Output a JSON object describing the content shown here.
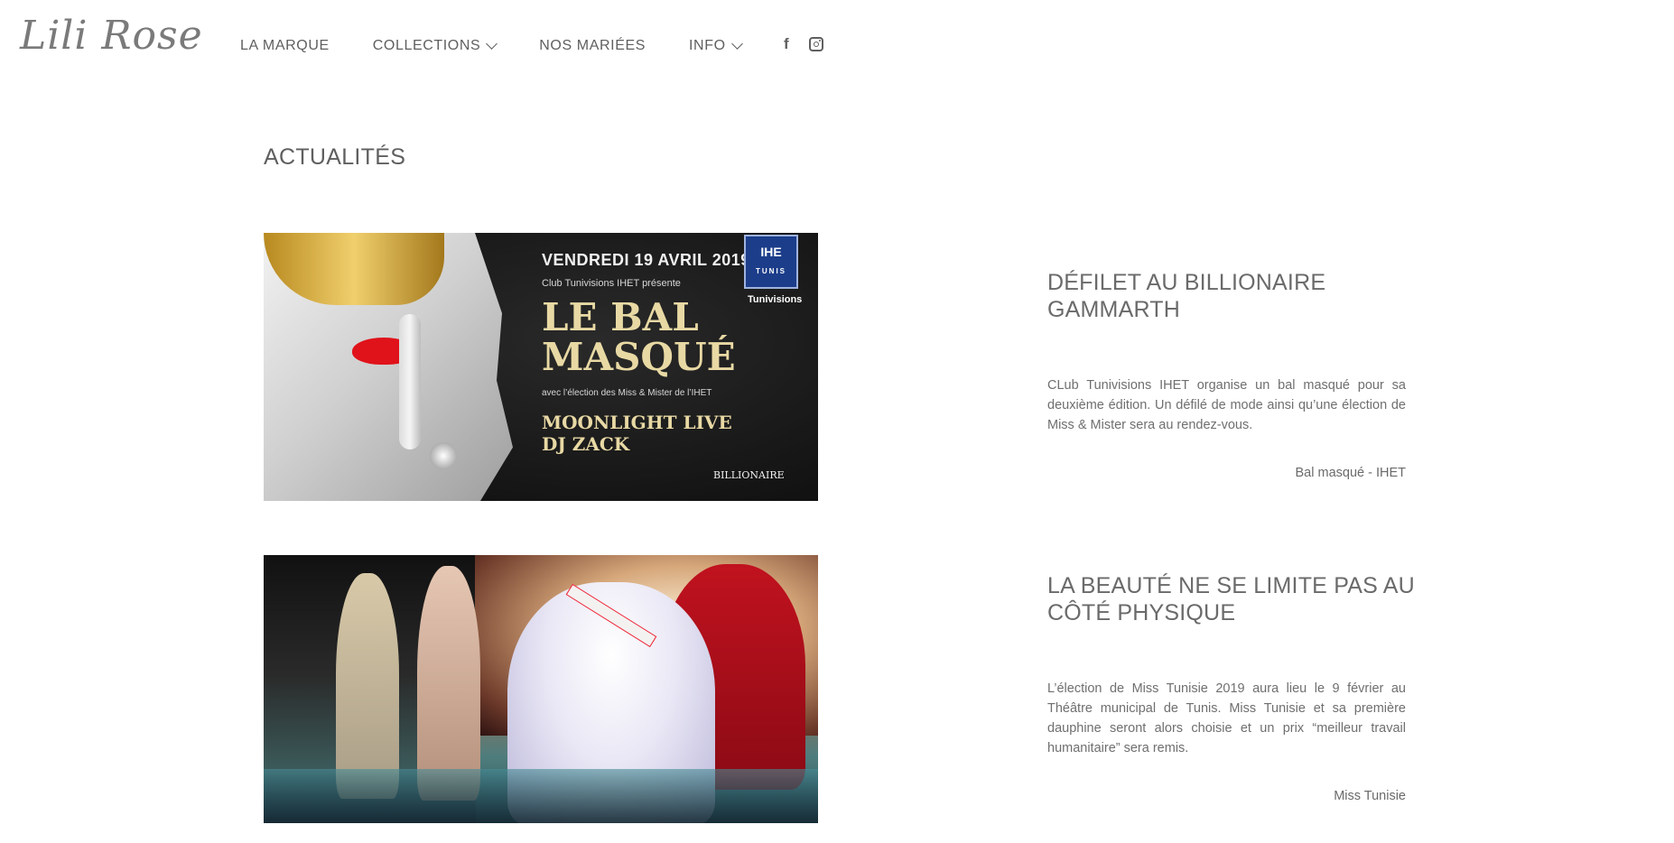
{
  "header": {
    "logo": "Lili Rose",
    "nav": [
      {
        "label": "LA MARQUE",
        "dropdown": false
      },
      {
        "label": "COLLECTIONS",
        "dropdown": true
      },
      {
        "label": "NOS MARIÉES",
        "dropdown": false
      },
      {
        "label": "INFO",
        "dropdown": true
      }
    ],
    "social": {
      "facebook_glyph": "f",
      "icons": [
        "facebook-icon",
        "instagram-icon"
      ]
    }
  },
  "page": {
    "title": "ACTUALITÉS"
  },
  "articles": [
    {
      "title": "DÉFILET AU BILLIONAIRE GAMMARTH",
      "text": "CLub Tunivisions IHET organise un bal masqué pour sa deuxième édition. Un défilé de mode ainsi qu’une élection de Miss & Mister sera au rendez-vous.",
      "tag": "Bal masqué - IHET",
      "poster": {
        "date": "VENDREDI 19 AVRIL 2019",
        "club": "Club Tunivisions IHET présente",
        "headline_1": "LE BAL",
        "headline_2": "MASQUÉ",
        "subline": "avec l’élection des Miss & Mister de l’IHET",
        "live_1": "MOONLIGHT LIVE",
        "live_2": "DJ ZACK",
        "badge_top": "IHE",
        "badge_bottom": "TUNIS",
        "tunivisions": "Tunivisions",
        "venue": "BILLIONAIRE"
      }
    },
    {
      "title": "LA BEAUTÉ NE SE LIMITE PAS AU CÔTÉ PHYSIQUE",
      "text": "L’élection de Miss Tunisie 2019 aura lieu le 9 février au Théâtre municipal de Tunis. Miss Tunisie et sa première dauphine seront alors choisie et un prix “meilleur travail humanitaire” sera remis.",
      "tag": "Miss Tunisie"
    }
  ],
  "colors": {
    "text": "#6b6b6b",
    "background": "#ffffff",
    "accent_red": "#e0121a",
    "accent_gold": "#e8d9a4"
  }
}
